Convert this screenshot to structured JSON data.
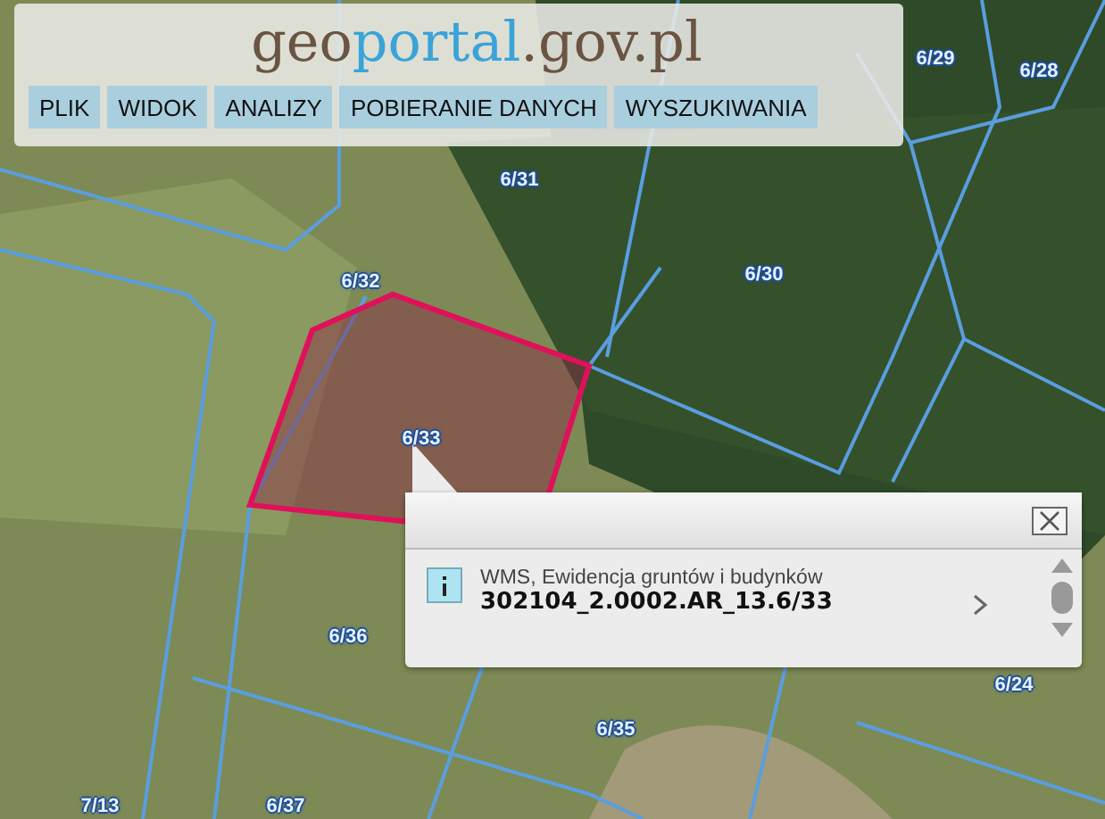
{
  "logo": [
    "geo",
    "portal",
    ".gov.pl"
  ],
  "menu": [
    {
      "label": "PLIK"
    },
    {
      "label": "WIDOK"
    },
    {
      "label": "ANALIZY"
    },
    {
      "label": "POBIERANIE DANYCH"
    },
    {
      "label": "WYSZUKIWANIA"
    }
  ],
  "map_labels": [
    {
      "text": "6/29"
    },
    {
      "text": "6/28"
    },
    {
      "text": "6/31"
    },
    {
      "text": "6/30"
    },
    {
      "text": "6/32"
    },
    {
      "text": "6/33"
    },
    {
      "text": "6/36"
    },
    {
      "text": "6/24"
    },
    {
      "text": "6/35"
    },
    {
      "text": "7/13"
    },
    {
      "text": "6/37"
    }
  ],
  "popup": {
    "source": "WMS, Ewidencja gruntów i budynków",
    "id": "302104_2.0002.AR_13.6/33"
  }
}
